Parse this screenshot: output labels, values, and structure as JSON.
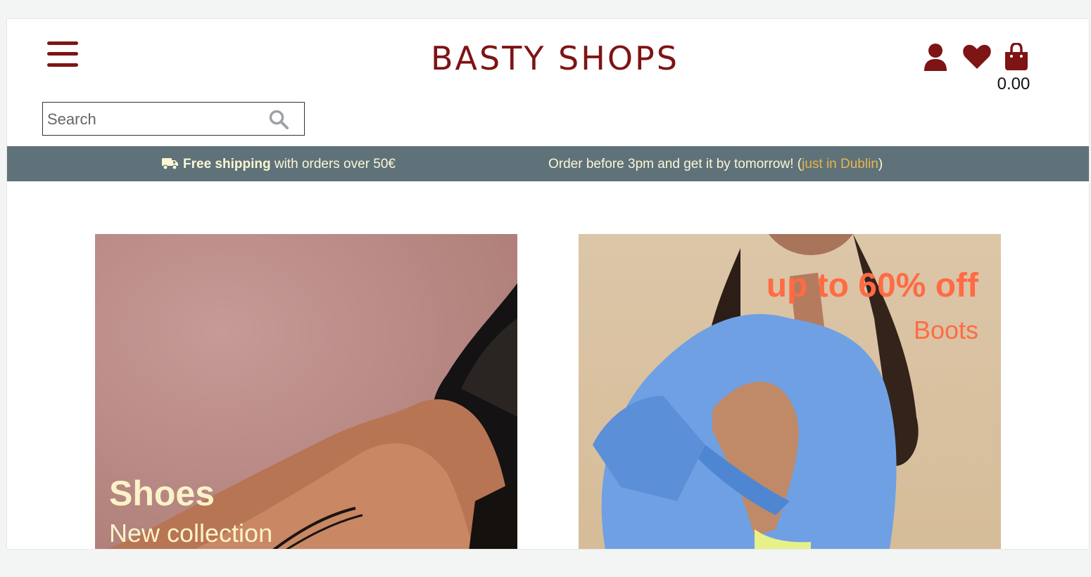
{
  "header": {
    "brand": "BASTY SHOPS",
    "bag_total": "0.00",
    "menu_icon": "hamburger-menu-icon",
    "account_icon": "user-icon",
    "wishlist_icon": "heart-icon",
    "bag_icon": "shopping-bag-icon",
    "brand_color": "#7e1414"
  },
  "search": {
    "placeholder": "Search",
    "value": "",
    "icon": "search-icon"
  },
  "infobar": {
    "shipping_bold": "Free shipping",
    "shipping_rest": " with orders over 50€",
    "order_text": "Order before 3pm and get it by tomorrow! (",
    "order_highlight": "just in Dublin",
    "order_close": ")",
    "background": "#5f727a",
    "accent": "#e7b54b",
    "truck_icon": "truck-icon"
  },
  "banners": [
    {
      "title": "Shoes",
      "subtitle": "New collection",
      "text_color": "#fbf3c8"
    },
    {
      "title": "up to 60% off",
      "subtitle": "Boots",
      "text_color": "#ff6b45"
    }
  ]
}
